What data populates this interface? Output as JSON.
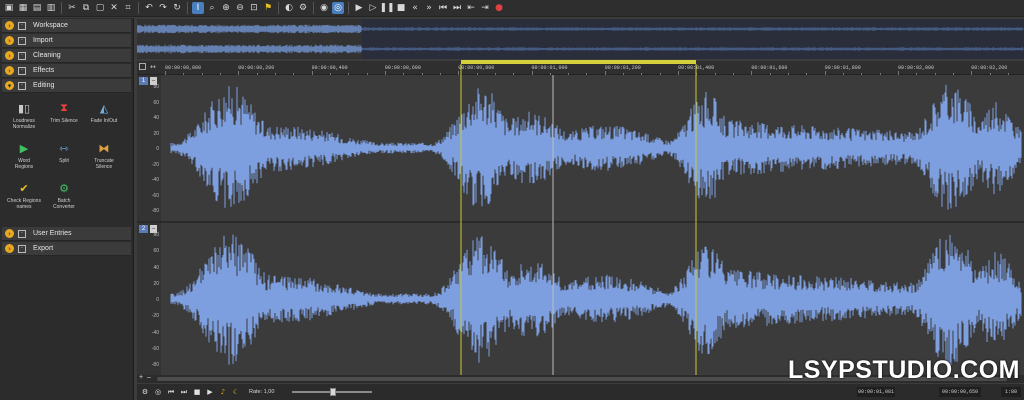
{
  "toolbar": {
    "icons": [
      "open-icon",
      "save-icon",
      "save-as-icon",
      "save-all-icon",
      "cut-icon",
      "copy-icon",
      "paste-icon",
      "delete-icon",
      "crop-icon",
      "undo-icon",
      "redo-icon",
      "history-icon",
      "select-tool-icon",
      "zoom-tool-icon",
      "zoom-in-icon",
      "zoom-out-icon",
      "zoom-fit-icon",
      "marker-icon",
      "tool-icon",
      "record-settings-icon",
      "record-icon",
      "loop-icon",
      "play-icon",
      "play-selection-icon",
      "pause-icon",
      "stop-icon",
      "rewind-icon",
      "fast-forward-icon",
      "go-start-icon",
      "go-end-icon",
      "prev-marker-icon",
      "next-marker-icon",
      "record-button-icon"
    ]
  },
  "sidebar": {
    "sections_top": [
      {
        "label": "Workspace",
        "icon": "workspace-icon"
      },
      {
        "label": "Import",
        "icon": "import-icon"
      },
      {
        "label": "Cleaning",
        "icon": "cleaning-icon"
      },
      {
        "label": "Effects",
        "icon": "effects-icon"
      },
      {
        "label": "Editing",
        "icon": "editing-icon",
        "expanded": true
      }
    ],
    "tools": [
      {
        "label_1": "Loudness",
        "label_2": "Normalize",
        "icon": "loudness-normalize-icon"
      },
      {
        "label_1": "Trim Silence",
        "label_2": "",
        "icon": "trim-silence-icon"
      },
      {
        "label_1": "Fade In/Out",
        "label_2": "",
        "icon": "fade-in-out-icon"
      },
      {
        "label_1": "Word",
        "label_2": "Regions",
        "icon": "word-regions-icon"
      },
      {
        "label_1": "Split",
        "label_2": "",
        "icon": "split-icon"
      },
      {
        "label_1": "Truncate",
        "label_2": "Silence",
        "icon": "truncate-silence-icon"
      },
      {
        "label_1": "Check Regions",
        "label_2": "names",
        "icon": "check-regions-icon"
      },
      {
        "label_1": "Batch",
        "label_2": "Converter",
        "icon": "batch-converter-icon"
      }
    ],
    "sections_bottom": [
      {
        "label": "User Entries",
        "icon": "user-entries-icon"
      },
      {
        "label": "Export",
        "icon": "export-icon"
      }
    ]
  },
  "ruler": {
    "labels": [
      "00:00:00,000",
      "00:00:00,200",
      "00:00:00,400",
      "00:00:00,600",
      "00:00:00,800",
      "00:00:01,000",
      "00:00:01,200",
      "00:00:01,400",
      "00:00:01,600",
      "00:00:01,800",
      "00:00:02,000",
      "00:00:02,200"
    ]
  },
  "channels": [
    {
      "number": "1",
      "minimize": "–",
      "axis": [
        "80",
        "60",
        "40",
        "20",
        "0",
        "-20",
        "-40",
        "-60",
        "-80"
      ]
    },
    {
      "number": "2",
      "minimize": "–",
      "axis": [
        "80",
        "60",
        "40",
        "20",
        "0",
        "-20",
        "-40",
        "-60",
        "-80"
      ]
    }
  ],
  "bottom": {
    "zoom_plus": "+",
    "zoom_minus": "–",
    "rate_label": "Rate: 1,00",
    "position": "00:00:01,081",
    "selection_length": "00:00:00,650",
    "zoom": "1:80"
  },
  "watermark": "LSYPSTUDIO.COM",
  "colors": {
    "waveform": "#7d9fe0",
    "selection_bar": "#d6cf3c",
    "selection_line": "#c9c93a",
    "accent": "#4a7fbf",
    "chevron": "#e8a820"
  }
}
